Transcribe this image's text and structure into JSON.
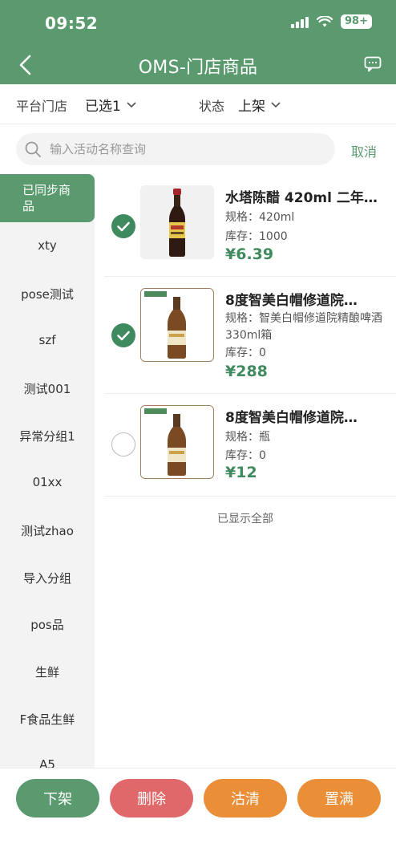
{
  "status_bar": {
    "time": "09:52",
    "battery": "98+"
  },
  "nav": {
    "title": "OMS-门店商品",
    "back_icon": "chevron-left-icon",
    "right_icon": "chat-icon"
  },
  "filters": {
    "store_label": "平台门店",
    "store_value": "已选1",
    "status_label": "状态",
    "status_value": "上架"
  },
  "search": {
    "placeholder": "输入活动名称查询",
    "value": "",
    "cancel_label": "取消"
  },
  "sidebar": {
    "active_line1": "已同步商",
    "active_line2": "品",
    "items": [
      {
        "label": "xty"
      },
      {
        "label": "pose测试"
      },
      {
        "label": "szf"
      },
      {
        "label": "测试001"
      },
      {
        "label": "异常分组1"
      },
      {
        "label": "01xx"
      },
      {
        "label": "测试zhao"
      },
      {
        "label": "导入分组"
      },
      {
        "label": "pos品"
      },
      {
        "label": "生鲜"
      },
      {
        "label": "F食品生鲜"
      },
      {
        "label": "A5"
      }
    ]
  },
  "products": [
    {
      "name": "水塔陈醋 420ml 二年…",
      "spec": "规格：420ml",
      "stock": "库存：1000",
      "price": "¥6.39",
      "checked": true
    },
    {
      "name": "8度智美白帽修道院…",
      "spec": "规格：智美白帽修道院精酿啤酒330ml箱",
      "stock": "库存：0",
      "price": "¥288",
      "checked": true
    },
    {
      "name": "8度智美白帽修道院…",
      "spec": "规格：瓶",
      "stock": "库存：0",
      "price": "¥12",
      "checked": false
    }
  ],
  "list_footer": "已显示全部",
  "actions": {
    "off_shelf": "下架",
    "delete": "删除",
    "clear_stock": "沽清",
    "fill_stock": "置满"
  },
  "colors": {
    "brand_green": "#5a9a6e",
    "price_green": "#3f8a5e",
    "delete_red": "#e0676a",
    "orange": "#ea8e38"
  }
}
